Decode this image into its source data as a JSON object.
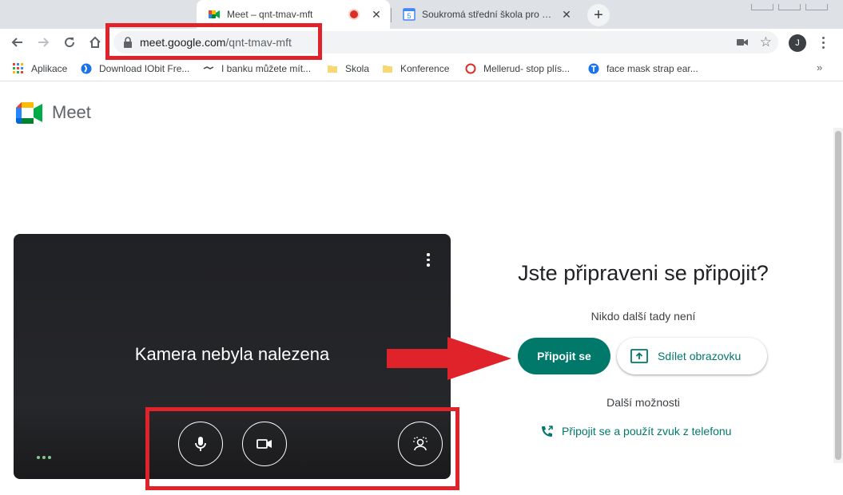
{
  "browser": {
    "tabs": [
      {
        "title": "Meet – qnt-tmav-mft",
        "active": true,
        "recording": true
      },
      {
        "title": "Soukromá střední škola pro mark",
        "active": false
      }
    ],
    "new_tab_label": "+",
    "url": {
      "host": "meet.google.com",
      "path": "/qnt-tmav-mft"
    },
    "profile_initial": "J",
    "bookmarks": [
      {
        "label": "Aplikace",
        "icon": "apps-grid-icon"
      },
      {
        "label": "Download IObit Fre...",
        "icon": "iobit-icon"
      },
      {
        "label": "I banku můžete mít...",
        "icon": "bank-logo-icon"
      },
      {
        "label": "Skola",
        "icon": "folder-icon"
      },
      {
        "label": "Konference",
        "icon": "folder-icon"
      },
      {
        "label": "Mellerud- stop plís...",
        "icon": "mellerud-icon"
      },
      {
        "label": "face mask strap ear...",
        "icon": "translate-icon"
      }
    ],
    "bookmarks_more": "»"
  },
  "meet": {
    "brand": "Meet",
    "preview": {
      "no_camera_text": "Kamera nebyla nalezena",
      "controls": [
        "mic-icon",
        "camera-icon",
        "visual-effects-icon"
      ]
    },
    "ready_heading": "Jste připraveni se připojit?",
    "nobody_here": "Nikdo další tady není",
    "join_button": "Připojit se",
    "share_button": "Sdílet obrazovku",
    "more_options": "Další možnosti",
    "phone_option": "Připojit se a použít zvuk z telefonu"
  },
  "colors": {
    "accent": "#00796b",
    "annotation": "#e0232a",
    "preview_bg": "#202124"
  }
}
